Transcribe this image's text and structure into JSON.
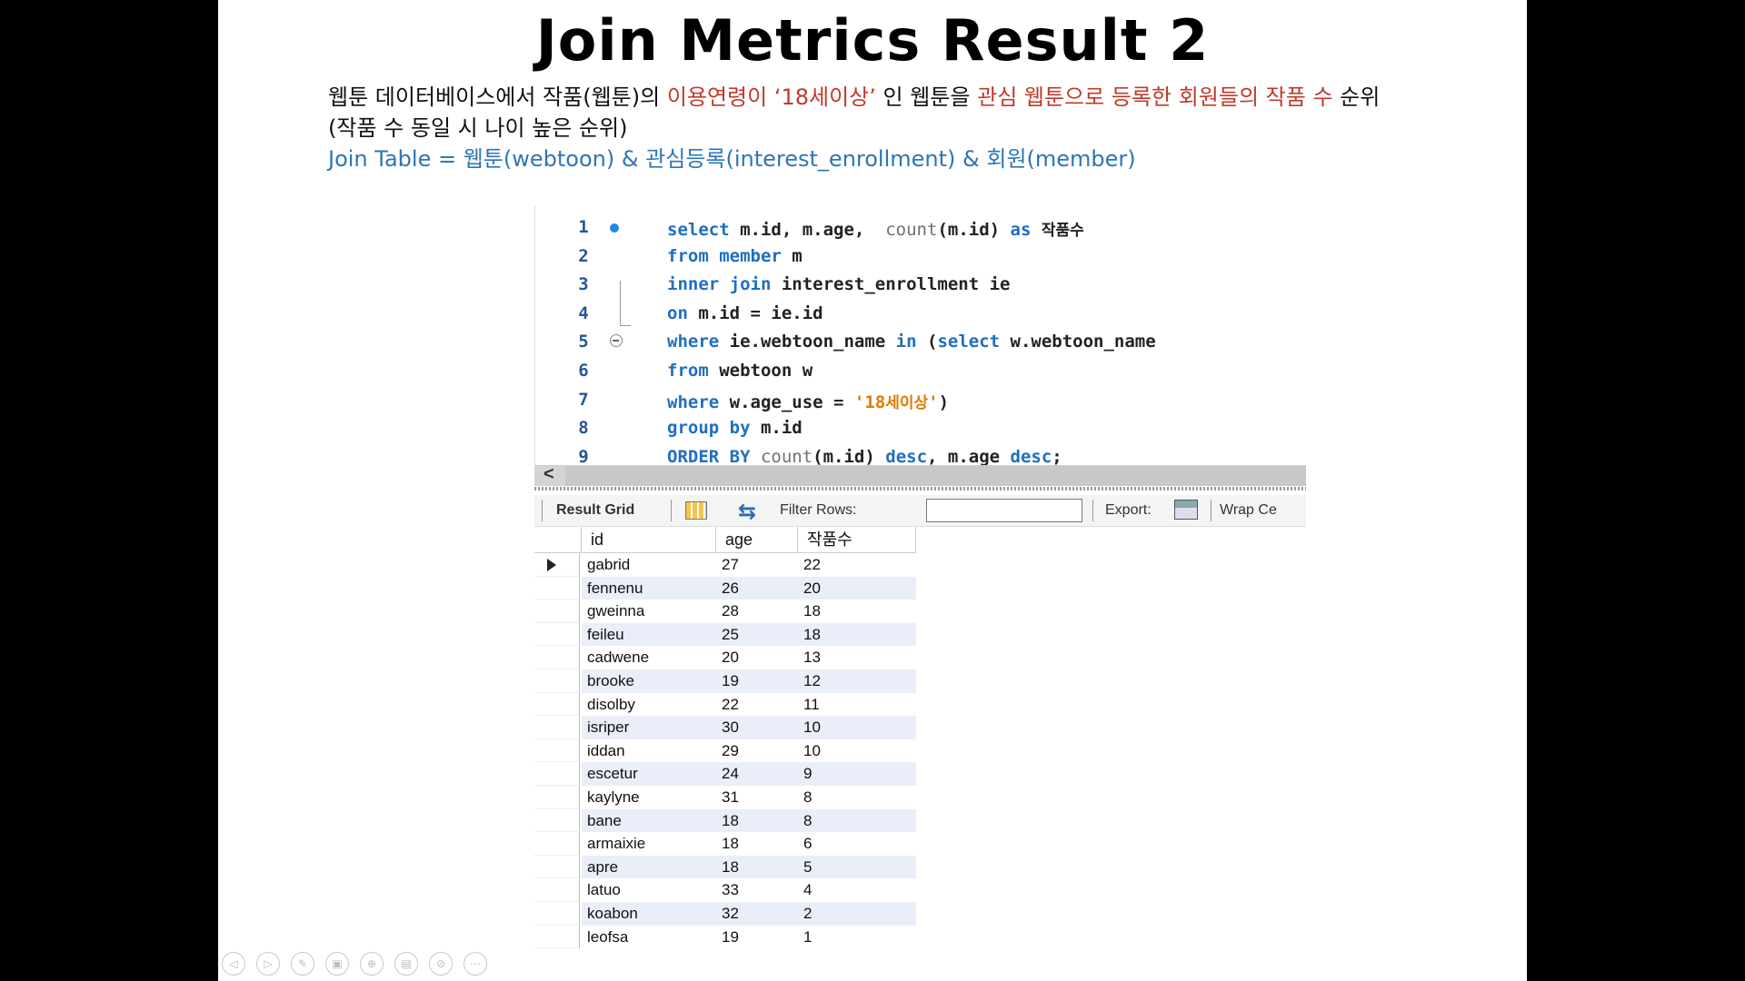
{
  "slide": {
    "title": "Join Metrics Result 2",
    "desc_line1_a": "웹툰 데이터베이스에서 작품(웹툰)의 ",
    "desc_line1_red1": "이용연령이 ‘18세이상’",
    "desc_line1_b": " 인 웹툰을 ",
    "desc_line1_red2": "관심 웹툰으로 등록한 회원들의 작품 수",
    "desc_line1_c": " 순위",
    "desc_line2": "(작품 수 동일 시 나이 높은 순위)",
    "join_line": "Join Table  = 웹툰(webtoon) & 관심등록(interest_enrollment) & 회원(member)"
  },
  "editor": {
    "lines": [
      {
        "n": "1",
        "kw1": "select",
        "t1": " m.id, m.age,  ",
        "fn": "count",
        "t2": "(m.id) ",
        "kw2": "as",
        "t3": " ",
        "kor": "작품수",
        "str": ""
      },
      {
        "n": "2",
        "kw1": "from",
        "t1": " ",
        "kw2": "member",
        "t2": " m",
        "fn": "",
        "t3": "",
        "kor": "",
        "str": ""
      },
      {
        "n": "3",
        "kw1": "inner join",
        "t1": " interest_enrollment ie",
        "fn": "",
        "t2": "",
        "kw2": "",
        "t3": "",
        "kor": "",
        "str": ""
      },
      {
        "n": "4",
        "kw1": "on",
        "t1": " m.id = ie.id",
        "fn": "",
        "t2": "",
        "kw2": "",
        "t3": "",
        "kor": "",
        "str": ""
      },
      {
        "n": "5",
        "kw1": "where",
        "t1": " ie.webtoon_name ",
        "kw2": "in",
        "t2": " (",
        "kw3": "select",
        "t3": " w.webtoon_name",
        "fn": "",
        "kor": "",
        "str": ""
      },
      {
        "n": "6",
        "kw1": "from",
        "t1": " webtoon w",
        "fn": "",
        "t2": "",
        "kw2": "",
        "t3": "",
        "kor": "",
        "str": ""
      },
      {
        "n": "7",
        "kw1": "where",
        "t1": " w.age_use = ",
        "str": "'18",
        "kor": "세이상",
        "str2": "'",
        "t2": ")",
        "fn": "",
        "kw2": "",
        "t3": ""
      },
      {
        "n": "8",
        "kw1": "group by",
        "t1": " m.id",
        "fn": "",
        "t2": "",
        "kw2": "",
        "t3": "",
        "kor": "",
        "str": ""
      },
      {
        "n": "9",
        "kw1": "ORDER BY",
        "t1": " ",
        "fn": "count",
        "t2": "(m.id) ",
        "kw2": "desc",
        "t3": ", m.age ",
        "kw3": "desc",
        "t4": ";",
        "kor": "",
        "str": ""
      }
    ]
  },
  "toolbar": {
    "result_grid": "Result Grid",
    "filter_rows": "Filter Rows:",
    "filter_value": "",
    "export": "Export:",
    "wrap": "Wrap Ce"
  },
  "grid": {
    "columns": [
      "id",
      "age",
      "작품수"
    ],
    "rows": [
      [
        "gabrid",
        "27",
        "22"
      ],
      [
        "fennenu",
        "26",
        "20"
      ],
      [
        "gweinna",
        "28",
        "18"
      ],
      [
        "feileu",
        "25",
        "18"
      ],
      [
        "cadwene",
        "20",
        "13"
      ],
      [
        "brooke",
        "19",
        "12"
      ],
      [
        "disolby",
        "22",
        "11"
      ],
      [
        "isriper",
        "30",
        "10"
      ],
      [
        "iddan",
        "29",
        "10"
      ],
      [
        "escetur",
        "24",
        "9"
      ],
      [
        "kaylyne",
        "31",
        "8"
      ],
      [
        "bane",
        "18",
        "8"
      ],
      [
        "armaixie",
        "18",
        "6"
      ],
      [
        "apre",
        "18",
        "5"
      ],
      [
        "latuo",
        "33",
        "4"
      ],
      [
        "koabon",
        "32",
        "2"
      ],
      [
        "leofsa",
        "19",
        "1"
      ]
    ]
  },
  "colors": {
    "accent_red": "#c0392b",
    "accent_blue": "#2e75b6",
    "keyword": "#1f6fbf",
    "string": "#e07b00",
    "row_alt": "#e9eef8"
  },
  "icons": [
    "result-grid-icon",
    "refresh-icon",
    "export-icon",
    "row-pointer-icon",
    "scroll-left-icon"
  ]
}
